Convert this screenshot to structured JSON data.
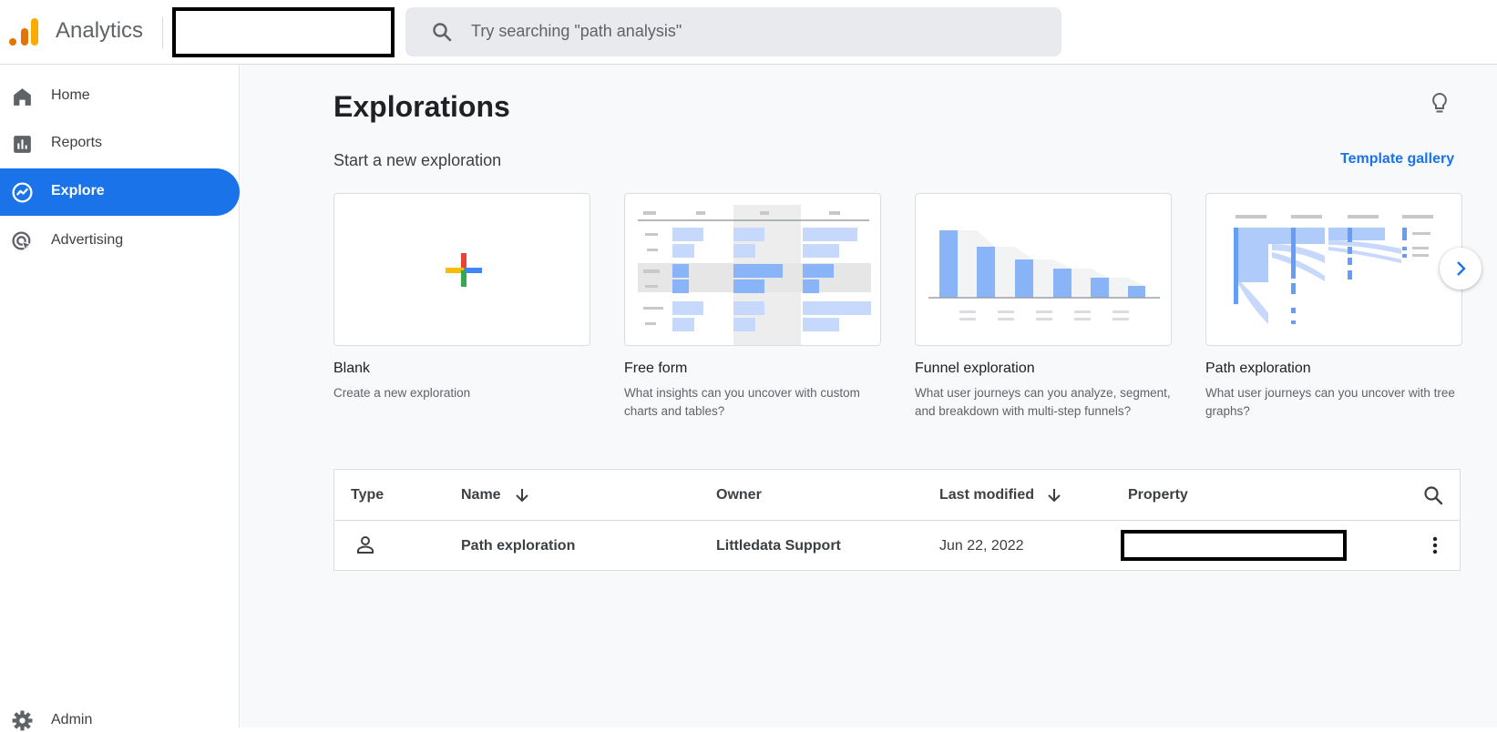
{
  "header": {
    "app_name": "Analytics",
    "search_placeholder": "Try searching \"path analysis\""
  },
  "sidebar": {
    "items": [
      {
        "label": "Home",
        "icon": "home-icon"
      },
      {
        "label": "Reports",
        "icon": "bar-chart-icon"
      },
      {
        "label": "Explore",
        "icon": "explore-icon",
        "active": true
      },
      {
        "label": "Advertising",
        "icon": "advertising-icon"
      }
    ],
    "admin_label": "Admin"
  },
  "main": {
    "title": "Explorations",
    "subtitle": "Start a new exploration",
    "template_link": "Template gallery",
    "cards": [
      {
        "title": "Blank",
        "description": "Create a new exploration"
      },
      {
        "title": "Free form",
        "description": "What insights can you uncover with custom charts and tables?"
      },
      {
        "title": "Funnel exploration",
        "description": "What user journeys can you analyze, segment, and breakdown with multi-step funnels?"
      },
      {
        "title": "Path exploration",
        "description": "What user journeys can you uncover with tree graphs?"
      }
    ]
  },
  "table": {
    "columns": {
      "type": "Type",
      "name": "Name",
      "owner": "Owner",
      "last_modified": "Last modified",
      "property": "Property"
    },
    "rows": [
      {
        "type_icon": "person-icon",
        "name": "Path exploration",
        "owner": "Littledata Support",
        "last_modified": "Jun 22, 2022",
        "property": ""
      }
    ]
  },
  "colors": {
    "accent": "#1a73e8",
    "chart_blue": "#8ab4f8",
    "logo_orange": "#f9ab00",
    "logo_dark_orange": "#e37400"
  }
}
